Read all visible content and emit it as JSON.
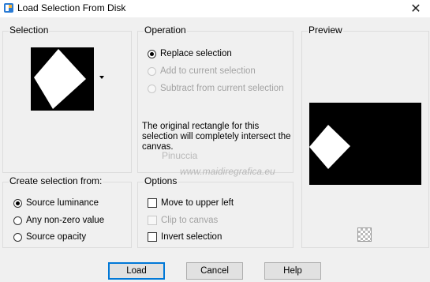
{
  "window": {
    "title": "Load Selection From Disk",
    "close_glyph": "✕"
  },
  "selection": {
    "group_label": "Selection"
  },
  "operation": {
    "group_label": "Operation",
    "options": [
      {
        "label": "Replace selection",
        "checked": true,
        "disabled": false
      },
      {
        "label": "Add to current selection",
        "checked": false,
        "disabled": true
      },
      {
        "label": "Subtract from current selection",
        "checked": false,
        "disabled": true
      }
    ],
    "description": "The original rectangle for this selection will completely intersect the canvas."
  },
  "preview": {
    "group_label": "Preview"
  },
  "create_from": {
    "group_label": "Create selection from:",
    "options": [
      {
        "label": "Source luminance",
        "checked": true
      },
      {
        "label": "Any non-zero value",
        "checked": false
      },
      {
        "label": "Source opacity",
        "checked": false
      }
    ]
  },
  "options_group": {
    "group_label": "Options",
    "items": [
      {
        "label": "Move to upper left",
        "checked": false,
        "disabled": false
      },
      {
        "label": "Clip to canvas",
        "checked": false,
        "disabled": true
      },
      {
        "label": "Invert selection",
        "checked": false,
        "disabled": false
      }
    ]
  },
  "buttons": {
    "load": "Load",
    "cancel": "Cancel",
    "help": "Help"
  },
  "watermark": {
    "line1": "Pinuccia",
    "line2": "www.maidiregrafica.eu"
  }
}
